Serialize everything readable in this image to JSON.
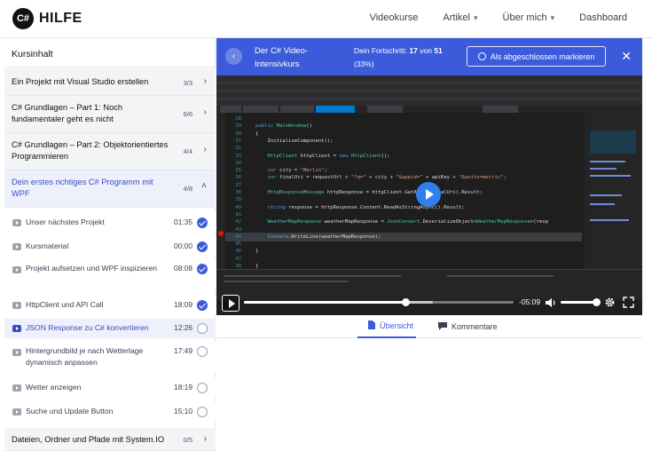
{
  "header": {
    "logo_badge": "C#",
    "logo_text": "HILFE",
    "nav": [
      "Videokurse",
      "Artikel",
      "Über mich",
      "Dashboard"
    ]
  },
  "sidebar": {
    "title": "Kursinhalt",
    "sections": [
      {
        "title": "Ein Projekt mit Visual Studio erstellen",
        "count": "3/3"
      },
      {
        "title": "C# Grundlagen – Part 1: Noch fundamentaler geht es nicht",
        "count": "6/6"
      },
      {
        "title": "C# Grundlagen – Part 2: Objektorientiertes Programmieren",
        "count": "4/4"
      },
      {
        "title": "Dein erstes richtiges C# Programm mit WPF",
        "count": "4/8"
      },
      {
        "title": "Dateien, Ordner und Pfade mit System.IO",
        "count": "0/5"
      }
    ],
    "lessons": [
      {
        "title": "Unser nächstes Projekt",
        "time": "01:35",
        "done": true
      },
      {
        "title": "Kursmaterial",
        "time": "00:00",
        "done": true
      },
      {
        "title": "Projekt aufsetzen und WPF inspizieren",
        "time": "08:08",
        "done": true
      },
      {
        "title": "HttpClient und API Call",
        "time": "18:09",
        "done": true
      },
      {
        "title": "JSON Response zu C# konvertieren",
        "time": "12:26",
        "done": false
      },
      {
        "title": "Hintergrundbild je nach Wetterlage dynamisch anpassen",
        "time": "17:49",
        "done": false
      },
      {
        "title": "Wetter anzeigen",
        "time": "18:19",
        "done": false
      },
      {
        "title": "Suche und Update Button",
        "time": "15:10",
        "done": false
      }
    ]
  },
  "course_bar": {
    "course_name": "Der C# Video-Intensivkurs",
    "progress_label": "Dein Fortschritt:",
    "progress_done": "17",
    "progress_of": "von",
    "progress_total": "51",
    "progress_percent": "(33%)",
    "complete_button": "Als abgeschlossen markieren"
  },
  "player": {
    "time_remaining": "-05:09",
    "progress_fraction": 0.6,
    "buffered_fraction": 0.7,
    "volume_fraction": 0.95
  },
  "code": [
    {
      "n": "28",
      "text": ""
    },
    {
      "n": "29",
      "text": "public MainWindow()"
    },
    {
      "n": "30",
      "text": "{"
    },
    {
      "n": "31",
      "text": "    InitializeComponent();"
    },
    {
      "n": "32",
      "text": ""
    },
    {
      "n": "33",
      "text": "    HttpClient httpClient = new HttpClient();"
    },
    {
      "n": "34",
      "text": ""
    },
    {
      "n": "35",
      "text": "    var city = \"Berlin\";"
    },
    {
      "n": "36",
      "text": "    var finalUri = requestUrl + \"?q=\" + city + \"&appid=\" + apiKey + \"&units=metric\";"
    },
    {
      "n": "37",
      "text": ""
    },
    {
      "n": "38",
      "text": "    HttpResponseMessage httpResponse = httpClient.GetAsync(finalUri).Result;"
    },
    {
      "n": "39",
      "text": ""
    },
    {
      "n": "40",
      "text": "    string response = httpResponse.Content.ReadAsStringAsync().Result;"
    },
    {
      "n": "41",
      "text": ""
    },
    {
      "n": "42",
      "text": "    WeatherMapResponse weatherMapResponse = JsonConvert.DeserializeObject<WeatherMapResponse>(resp"
    },
    {
      "n": "43",
      "text": ""
    },
    {
      "n": "44",
      "text": "    Console.WriteLine(weatherMapResponse);"
    },
    {
      "n": "45",
      "text": ""
    },
    {
      "n": "46",
      "text": "}"
    },
    {
      "n": "47",
      "text": ""
    },
    {
      "n": "48",
      "text": "}"
    }
  ],
  "tabs": [
    {
      "label": "Übersicht",
      "icon": "file-icon",
      "active": true
    },
    {
      "label": "Kommentare",
      "icon": "comment-icon",
      "active": false
    }
  ],
  "colors": {
    "accent": "#3b5bdb",
    "accent_text": "#3b4cc0"
  }
}
